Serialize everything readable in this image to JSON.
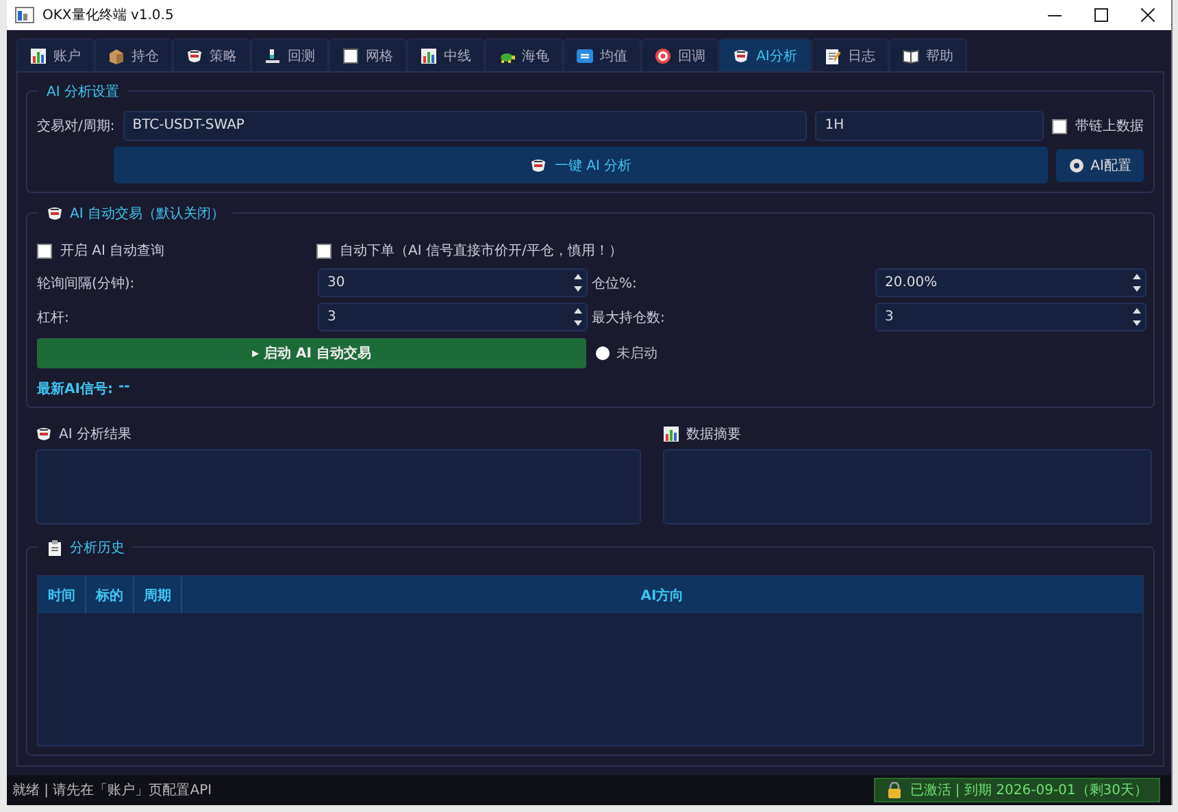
{
  "window": {
    "title": "OKX量化终端 v1.0.5"
  },
  "tabs": [
    {
      "label": "账户",
      "selected": false
    },
    {
      "label": "持仓",
      "selected": false
    },
    {
      "label": "策略",
      "selected": false
    },
    {
      "label": "回测",
      "selected": false
    },
    {
      "label": "网格",
      "selected": false
    },
    {
      "label": "中线",
      "selected": false
    },
    {
      "label": "海龟",
      "selected": false
    },
    {
      "label": "均值",
      "selected": false
    },
    {
      "label": "回调",
      "selected": false
    },
    {
      "label": "AI分析",
      "selected": true
    },
    {
      "label": "日志",
      "selected": false
    },
    {
      "label": "帮助",
      "selected": false
    }
  ],
  "analysis_settings": {
    "title": "AI 分析设置",
    "pair_label": "交易对/周期:",
    "symbol": "BTC-USDT-SWAP",
    "period": "1H",
    "onchain": {
      "label": "带链上数据",
      "checked": false
    },
    "analyze_button": "一键 AI 分析",
    "config_button": "AI配置"
  },
  "auto_trade": {
    "title": "AI 自动交易（默认关闭）",
    "auto_query": {
      "label": "开启 AI 自动查询",
      "checked": false
    },
    "auto_order": {
      "label": "自动下单（AI 信号直接市价开/平仓，慎用！）",
      "checked": false
    },
    "fields": [
      {
        "label": "轮询间隔(分钟):",
        "value": "30"
      },
      {
        "label": "仓位%:",
        "value": "20.00%"
      },
      {
        "label": "杠杆:",
        "value": "3"
      },
      {
        "label": "最大持仓数:",
        "value": "3"
      }
    ],
    "start_button": "▸ 启动 AI 自动交易",
    "running": false,
    "status": "未启动",
    "signal_label": "最新AI信号:",
    "signal": "--"
  },
  "panels": [
    {
      "title": "AI 分析结果"
    },
    {
      "title": "数据摘要"
    }
  ],
  "history": {
    "title": "分析历史",
    "columns": [
      "时间",
      "标的",
      "周期",
      "AI方向"
    ]
  },
  "status_bar": {
    "message": "就绪 | 请先在「账户」页配置API",
    "license": "已激活 | 到期 2026-09-01（剩30天）"
  }
}
